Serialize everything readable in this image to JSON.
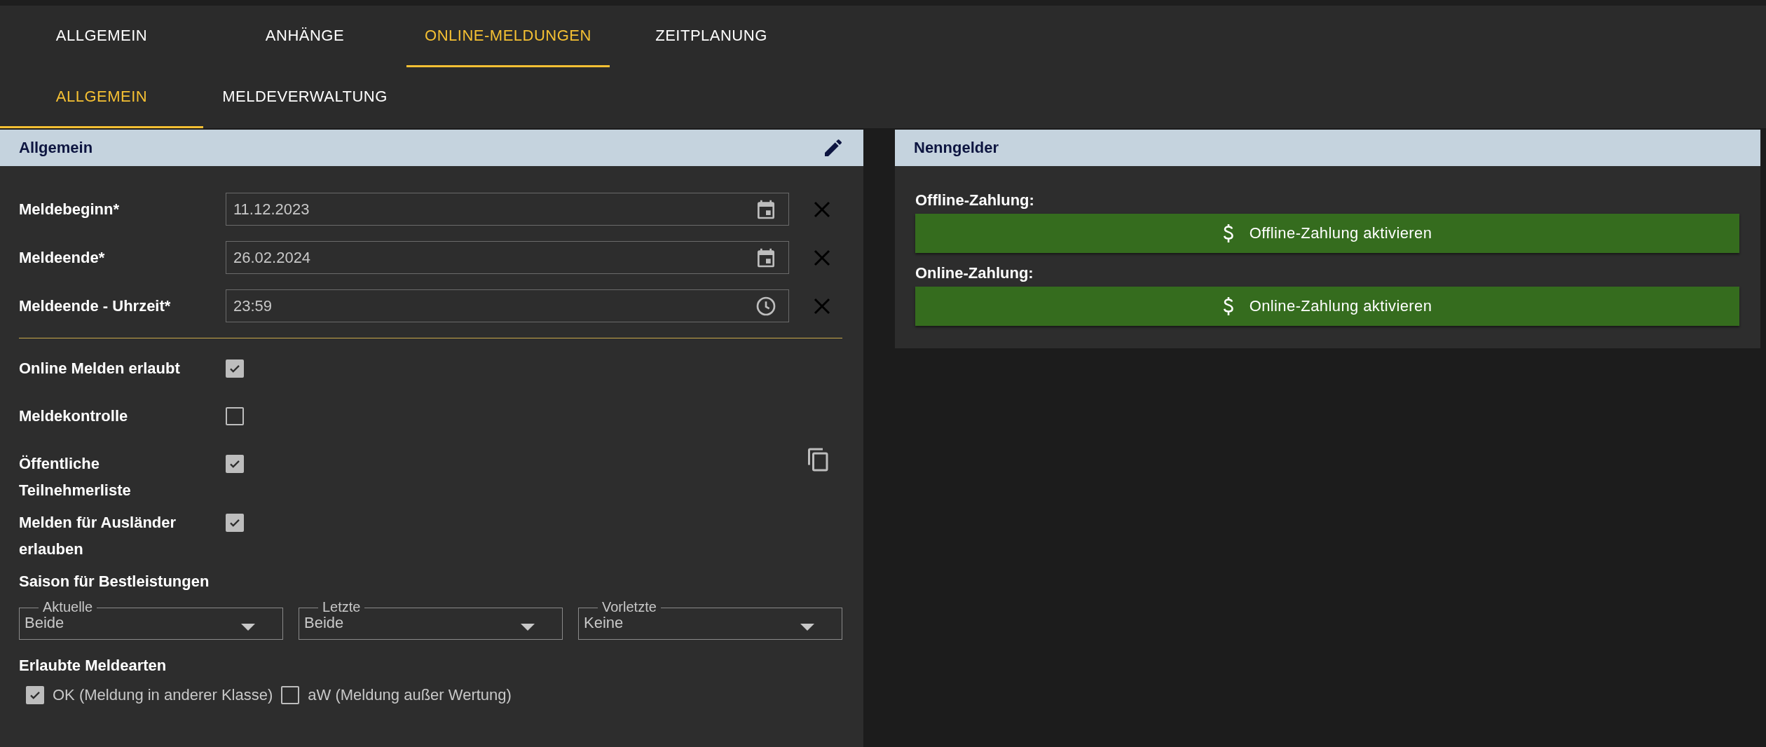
{
  "tabs": [
    {
      "label": "ALLGEMEIN",
      "selected": false
    },
    {
      "label": "ANHÄNGE",
      "selected": false
    },
    {
      "label": "ONLINE-MELDUNGEN",
      "selected": true
    },
    {
      "label": "ZEITPLANUNG",
      "selected": false
    }
  ],
  "subtabs": [
    {
      "label": "ALLGEMEIN",
      "selected": true
    },
    {
      "label": "MELDEVERWALTUNG",
      "selected": false
    }
  ],
  "allgemein": {
    "title": "Allgemein",
    "date_fields": [
      {
        "label": "Meldebeginn*",
        "value": "11.12.2023",
        "kind": "date"
      },
      {
        "label": "Meldeende*",
        "value": "26.02.2024",
        "kind": "date"
      },
      {
        "label": "Meldeende - Uhrzeit*",
        "value": "23:59",
        "kind": "time"
      }
    ],
    "checkboxes": [
      {
        "label": "Online Melden erlaubt",
        "checked": true
      },
      {
        "label": "Meldekontrolle",
        "checked": false
      },
      {
        "label": "Öffentliche Teilnehmerliste",
        "checked": true
      },
      {
        "label": "Melden für Ausländer erlauben",
        "checked": true
      }
    ],
    "season": {
      "title": "Saison für Bestleistungen",
      "selects": [
        {
          "label": "Aktuelle",
          "value": "Beide"
        },
        {
          "label": "Letzte",
          "value": "Beide"
        },
        {
          "label": "Vorletzte",
          "value": "Keine"
        }
      ]
    },
    "entry_types": {
      "title": "Erlaubte Meldearten",
      "options": [
        {
          "label": "OK (Meldung in anderer Klasse)",
          "checked": true
        },
        {
          "label": "aW (Meldung außer Wertung)",
          "checked": false
        }
      ]
    }
  },
  "nenngelder": {
    "title": "Nenngelder",
    "payments": [
      {
        "label": "Offline-Zahlung:",
        "button": "Offline-Zahlung aktivieren"
      },
      {
        "label": "Online-Zahlung:",
        "button": "Online-Zahlung aktivieren"
      }
    ]
  }
}
